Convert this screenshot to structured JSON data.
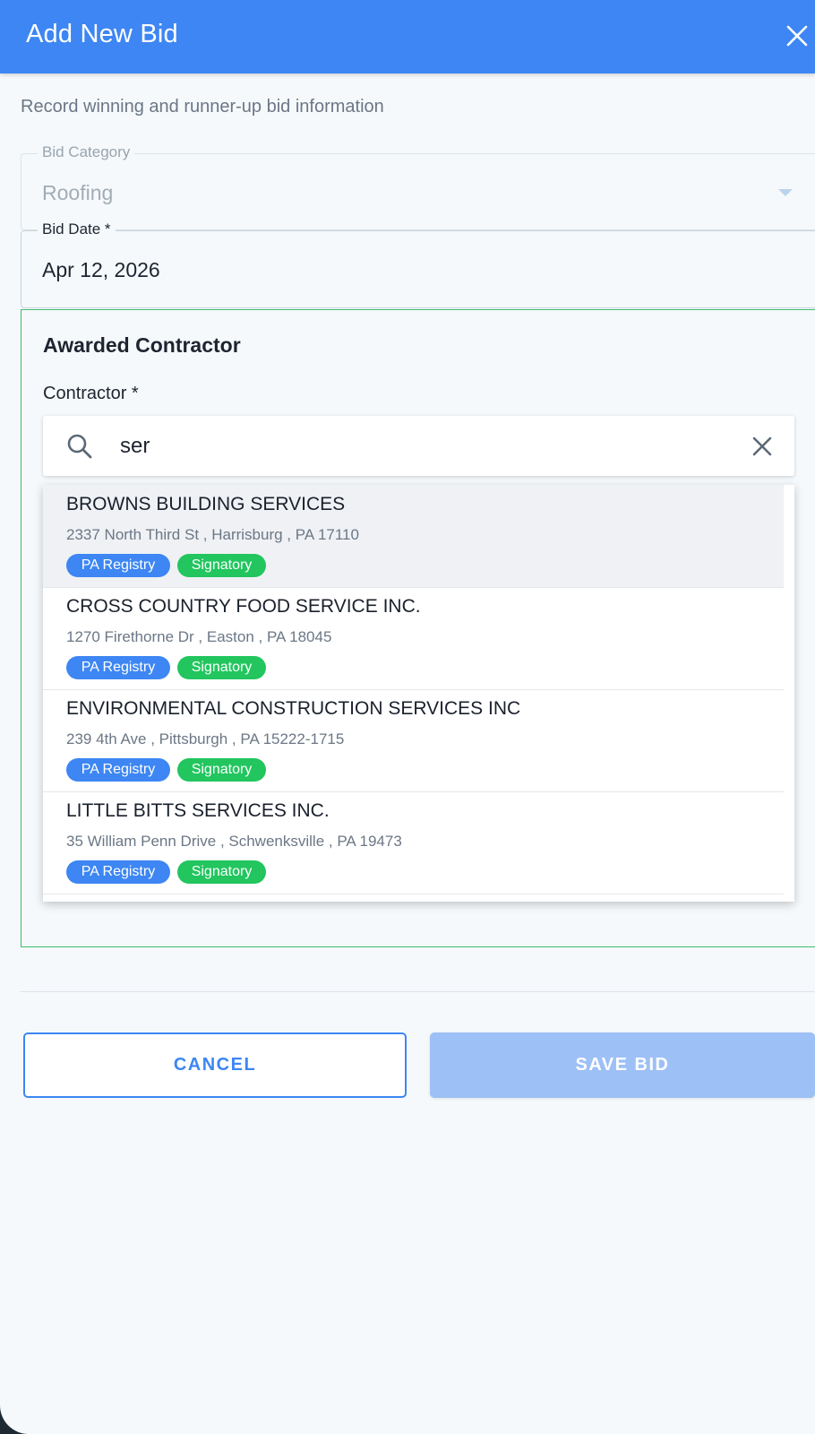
{
  "header": {
    "title": "Add New Bid",
    "close_icon": "close-icon",
    "color": "#3d86f3"
  },
  "subtitle": "Record winning and runner-up bid information",
  "bid_category": {
    "label": "Bid Category",
    "value": "Roofing",
    "disabled": true
  },
  "bid_date": {
    "label": "Bid Date *",
    "value": "Apr 12, 2026"
  },
  "awarded": {
    "title": "Awarded Contractor",
    "contractor_label": "Contractor *",
    "search": {
      "value": "ser",
      "icon": "search-icon",
      "clear_icon": "close-icon"
    },
    "results": [
      {
        "name": "BROWNS BUILDING SERVICES",
        "address": "2337 North Third St , Harrisburg , PA 17110",
        "badges": [
          "PA Registry",
          "Signatory"
        ],
        "highlighted": true
      },
      {
        "name": "CROSS COUNTRY FOOD SERVICE INC.",
        "address": "1270 Firethorne Dr , Easton , PA 18045",
        "badges": [
          "PA Registry",
          "Signatory"
        ],
        "highlighted": false
      },
      {
        "name": "ENVIRONMENTAL CONSTRUCTION SERVICES INC",
        "address": "239 4th Ave , Pittsburgh , PA 15222-1715",
        "badges": [
          "PA Registry",
          "Signatory"
        ],
        "highlighted": false
      },
      {
        "name": "LITTLE BITTS SERVICES INC.",
        "address": "35 William Penn Drive , Schwenksville , PA 19473",
        "badges": [
          "PA Registry",
          "Signatory"
        ],
        "highlighted": false
      }
    ]
  },
  "actions": {
    "cancel_label": "CANCEL",
    "save_label": "SAVE BID",
    "save_disabled": true
  },
  "colors": {
    "accent": "#3d86f3",
    "registry_badge": "#3d86f3",
    "signatory_badge": "#22c55e",
    "awarded_border": "#3dbd6e",
    "save_disabled": "#9dc0f6"
  }
}
